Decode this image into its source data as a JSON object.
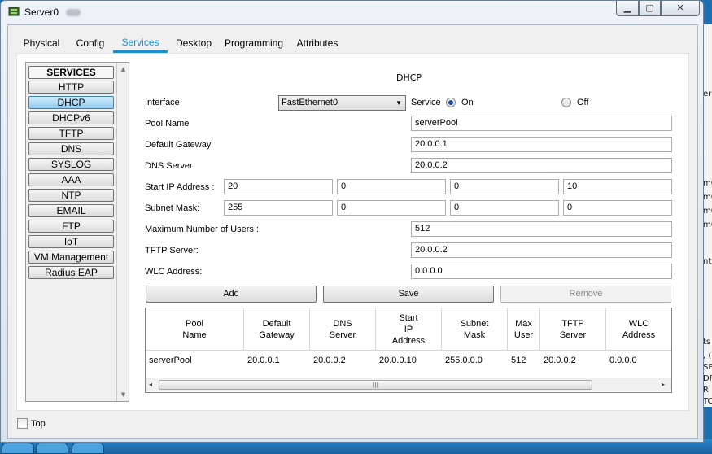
{
  "window": {
    "title": "Server0"
  },
  "tabs": [
    "Physical",
    "Config",
    "Services",
    "Desktop",
    "Programming",
    "Attributes"
  ],
  "active_tab": "Services",
  "services": {
    "header": "SERVICES",
    "items": [
      "HTTP",
      "DHCP",
      "DHCPv6",
      "TFTP",
      "DNS",
      "SYSLOG",
      "AAA",
      "NTP",
      "EMAIL",
      "FTP",
      "IoT",
      "VM Management",
      "Radius EAP"
    ],
    "active": "DHCP"
  },
  "dhcp": {
    "title": "DHCP",
    "interface_label": "Interface",
    "interface_value": "FastEthernet0",
    "service_label": "Service",
    "on_label": "On",
    "off_label": "Off",
    "service_on": true,
    "pool_name_label": "Pool Name",
    "pool_name": "serverPool",
    "gateway_label": "Default Gateway",
    "gateway": "20.0.0.1",
    "dns_label": "DNS Server",
    "dns": "20.0.0.2",
    "start_ip_label": "Start IP Address :",
    "start_ip": [
      "20",
      "0",
      "0",
      "10"
    ],
    "subnet_label": "Subnet Mask:",
    "subnet": [
      "255",
      "0",
      "0",
      "0"
    ],
    "max_users_label": "Maximum Number of Users :",
    "max_users": "512",
    "tftp_label": "TFTP Server:",
    "tftp": "20.0.0.2",
    "wlc_label": "WLC Address:",
    "wlc": "0.0.0.0",
    "buttons": {
      "add": "Add",
      "save": "Save",
      "remove": "Remove"
    }
  },
  "table": {
    "headers": [
      "Pool\nName",
      "Default\nGateway",
      "DNS\nServer",
      "Start\nIP\nAddress",
      "Subnet\nMask",
      "Max\nUser",
      "TFTP\nServer",
      "WLC\nAddress"
    ],
    "rows": [
      [
        "serverPool",
        "20.0.0.1",
        "20.0.0.2",
        "20.0.0.10",
        "255.0.0.0",
        "512",
        "20.0.0.2",
        "0.0.0.0"
      ]
    ]
  },
  "footer": {
    "top_label": "Top",
    "top_checked": false
  },
  "background_fragments": [
    "er",
    "m0",
    "m0",
    "m0",
    "m0",
    "nt",
    "ts",
    ", (",
    "SP",
    "DF",
    "R",
    "TC"
  ],
  "colors": {
    "accent": "#1e90d0",
    "window_frame": "#d9e3ee",
    "active_service": "#8ecbf0"
  }
}
